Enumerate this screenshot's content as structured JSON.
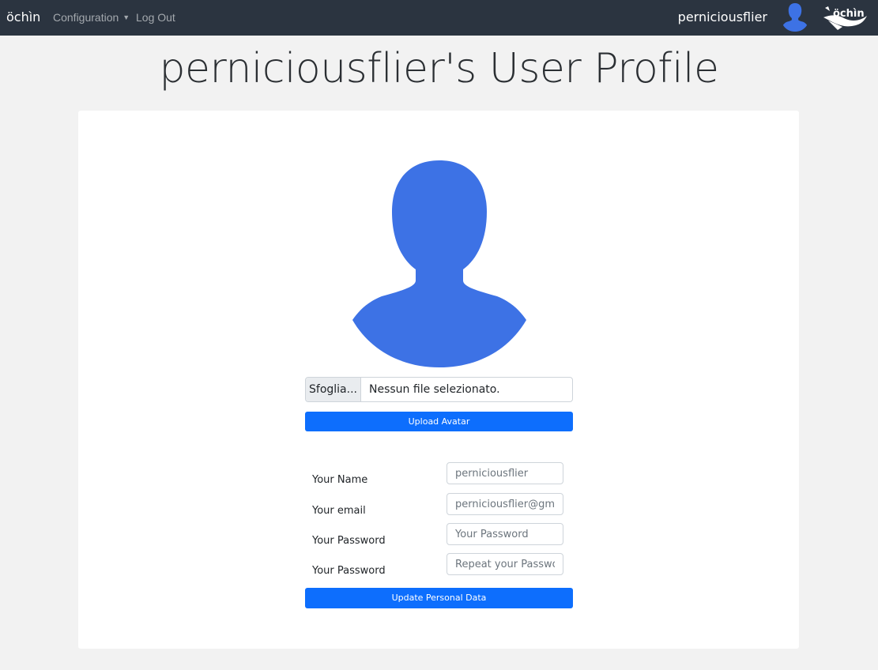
{
  "navbar": {
    "brand": "öchìn",
    "configuration_label": "Configuration",
    "logout_label": "Log Out",
    "username": "perniciousflier",
    "logo_text": "öchìn"
  },
  "page": {
    "title": "perniciousflier's User Profile"
  },
  "avatar_upload": {
    "browse_label": "Sfoglia...",
    "file_status": "Nessun file selezionato.",
    "upload_button": "Upload Avatar"
  },
  "form": {
    "name_label": "Your Name",
    "name_value": "perniciousflier",
    "email_label": "Your email",
    "email_value": "perniciousflier@gmail.com",
    "password_label": "Your Password",
    "password_placeholder": "Your Password",
    "password_repeat_label": "Your Password",
    "password_repeat_placeholder": "Repeat your Password",
    "update_button": "Update Personal Data"
  },
  "colors": {
    "navbar_bg": "#2b3440",
    "avatar_blue": "#3d72e5",
    "primary": "#0d6efd"
  }
}
